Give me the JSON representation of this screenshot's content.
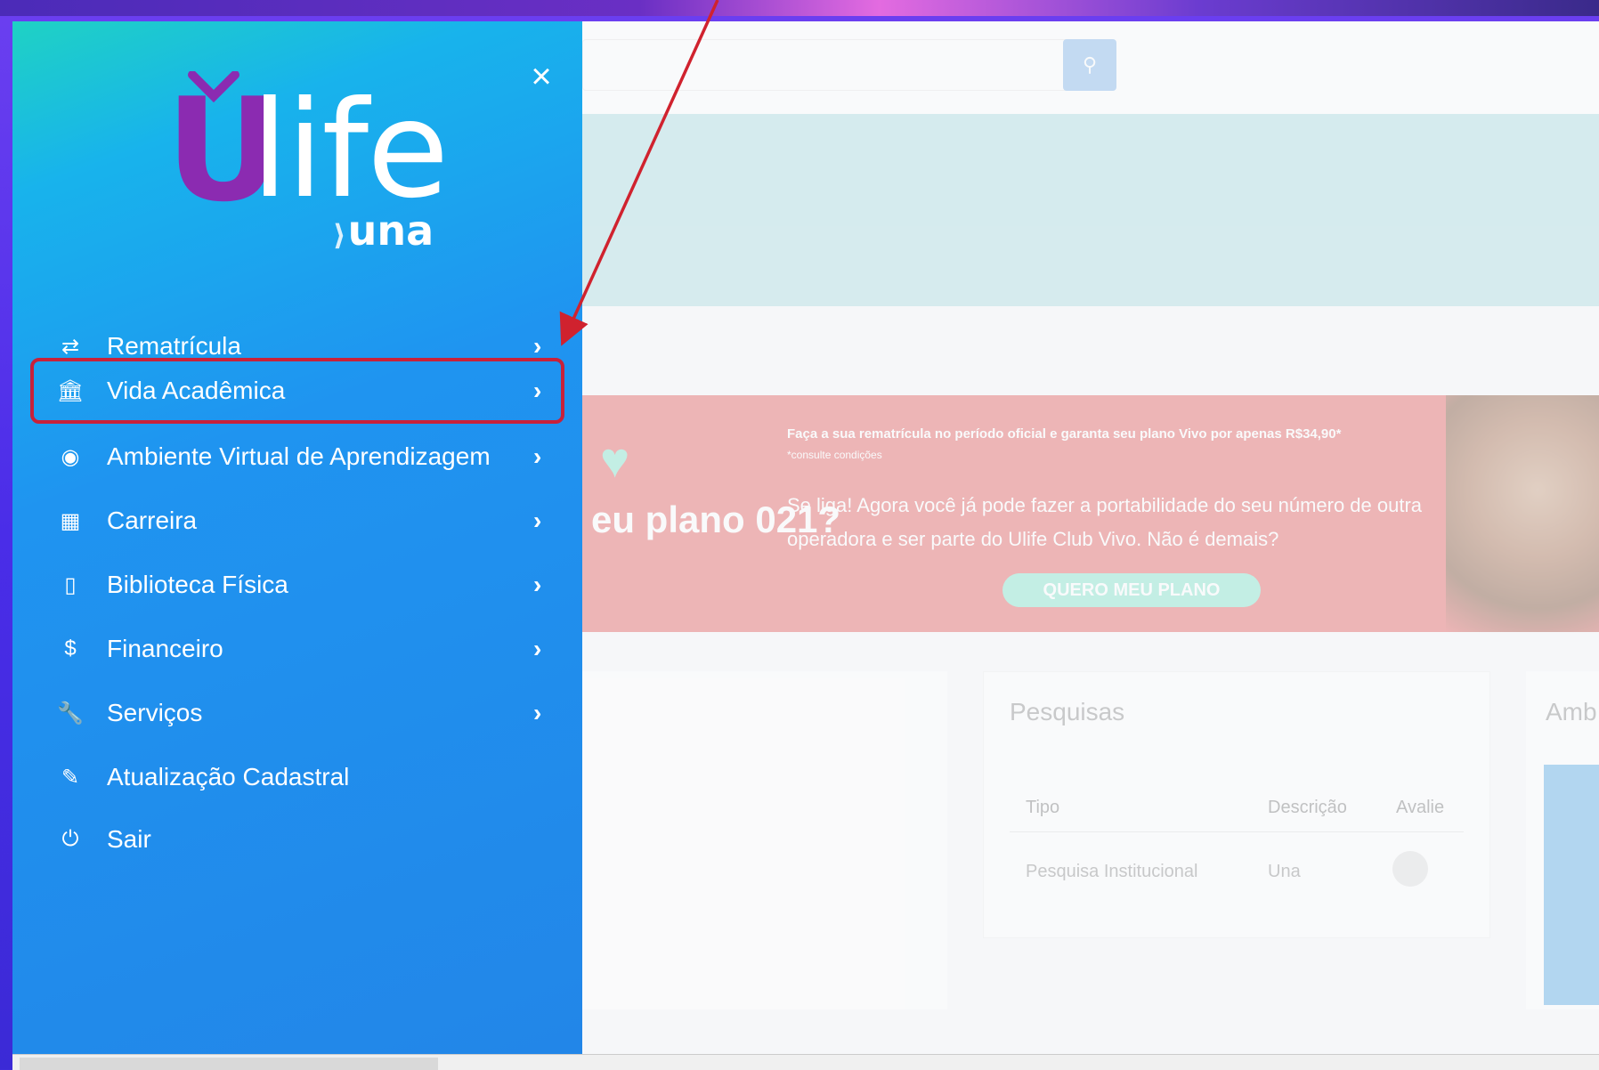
{
  "app": {
    "name": "Ulife",
    "brand": "una"
  },
  "search": {
    "button_icon": "search-icon"
  },
  "background": {
    "promo": {
      "headline": "eu plano 021?",
      "small": "Faça a sua rematrícula no período oficial e garanta seu plano Vivo por apenas R$34,90*",
      "tiny": "*consulte condições",
      "text": "Se liga! Agora você já pode fazer a portabilidade do seu número de outra operadora e ser parte do Ulife Club Vivo. Não é demais?",
      "button": "QUERO MEU PLANO"
    },
    "card": {
      "title": "Pesquisas",
      "headers": [
        "Tipo",
        "Descrição",
        "Avalie"
      ],
      "row": [
        "Pesquisa Institucional",
        "Una"
      ]
    },
    "card_right_title": "Amb"
  },
  "sidebar": {
    "close_label": "×",
    "logo": {
      "u": "U",
      "life": "life",
      "una": "una"
    },
    "items": [
      {
        "label": "Rematrícula",
        "icon": "exchange-icon",
        "has_chevron": true
      },
      {
        "label": "Vida Acadêmica",
        "icon": "bank-icon",
        "has_chevron": true,
        "highlighted": true
      },
      {
        "label": "Ambiente Virtual de Aprendizagem",
        "icon": "globe-icon",
        "has_chevron": true
      },
      {
        "label": "Carreira",
        "icon": "briefcase-icon",
        "has_chevron": true
      },
      {
        "label": "Biblioteca Física",
        "icon": "book-icon",
        "has_chevron": true
      },
      {
        "label": "Financeiro",
        "icon": "dollar-icon",
        "has_chevron": true
      },
      {
        "label": "Serviços",
        "icon": "wrench-icon",
        "has_chevron": true
      },
      {
        "label": "Atualização Cadastral",
        "icon": "edit-icon",
        "has_chevron": false
      },
      {
        "label": "Sair",
        "icon": "power-icon",
        "has_chevron": false
      }
    ],
    "chevron": "›"
  },
  "colors": {
    "sidebar": "#1f94f0",
    "logo_purple": "#8b2bb1",
    "highlight": "#c8213a",
    "promo": "#e25b5b"
  }
}
